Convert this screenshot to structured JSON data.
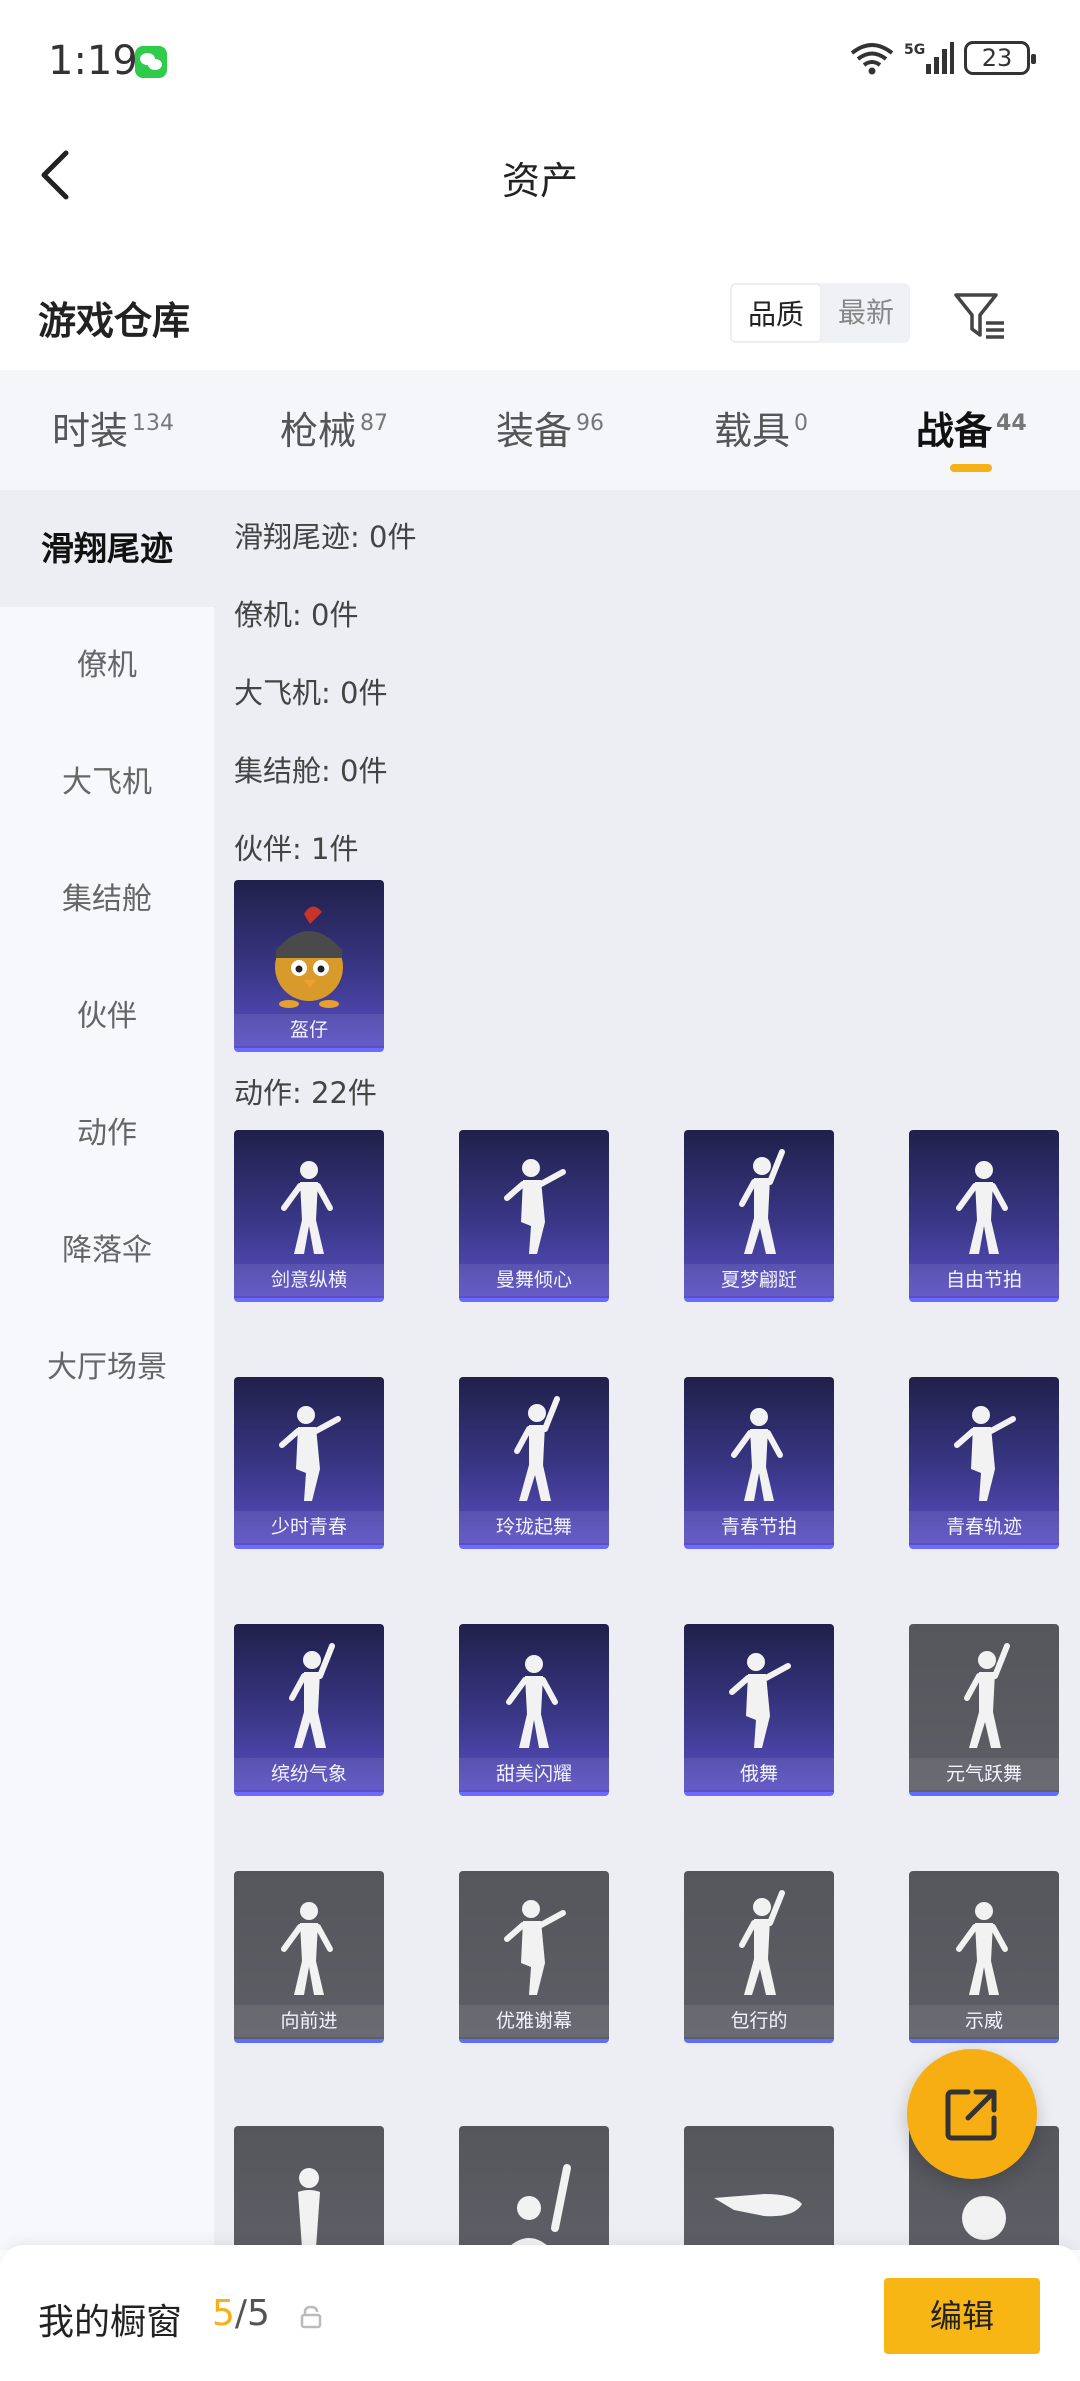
{
  "status": {
    "time": "1:19",
    "network": "5G",
    "battery": "23"
  },
  "nav": {
    "title": "资产"
  },
  "header": {
    "title": "游戏仓库",
    "sort_options": [
      "品质",
      "最新"
    ]
  },
  "tabs": [
    {
      "label": "时装",
      "count": "134"
    },
    {
      "label": "枪械",
      "count": "87"
    },
    {
      "label": "装备",
      "count": "96"
    },
    {
      "label": "载具",
      "count": "0"
    },
    {
      "label": "战备",
      "count": "44"
    }
  ],
  "sidebar": [
    "滑翔尾迹",
    "僚机",
    "大飞机",
    "集结舱",
    "伙伴",
    "动作",
    "降落伞",
    "大厅场景"
  ],
  "sections": {
    "trail": "滑翔尾迹: 0件",
    "wingman": "僚机: 0件",
    "plane": "大飞机: 0件",
    "pod": "集结舱: 0件",
    "partner": "伙伴: 1件",
    "emote": "动作: 22件"
  },
  "partner_items": [
    "盔仔"
  ],
  "emote_items": [
    "剑意纵横",
    "曼舞倾心",
    "夏梦翩跹",
    "自由节拍",
    "少时青春",
    "玲珑起舞",
    "青春节拍",
    "青春轨迹",
    "缤纷气象",
    "甜美闪耀",
    "俄舞",
    "元气跃舞",
    "向前进",
    "优雅谢幕",
    "包行的",
    "示威"
  ],
  "bottom": {
    "label": "我的橱窗",
    "count_current": "5",
    "count_total": "/5",
    "edit_label": "编辑"
  }
}
